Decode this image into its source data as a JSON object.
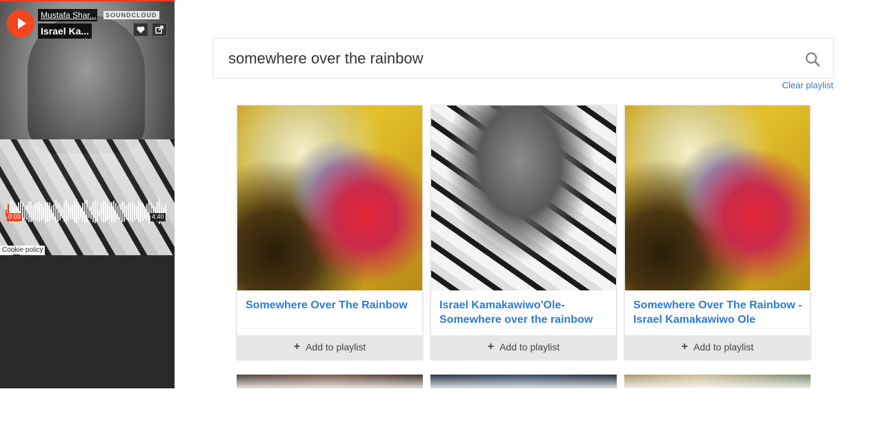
{
  "player": {
    "artist": "Mustafa Shar...",
    "track": "Israel Ka...",
    "brand": "SOUNDCLOUD",
    "current_time": "0:03",
    "duration": "4:40",
    "cookie_policy": "Cookie policy",
    "accent_color": "#f5451e"
  },
  "search": {
    "value": "somewhere over the rainbow",
    "icon": "search-icon"
  },
  "clear_playlist": "Clear playlist",
  "results": [
    {
      "title": "Somewhere Over The Rainbow",
      "add_label": "Add to playlist"
    },
    {
      "title": "Israel Kamakawiwo'Ole- Somewhere over the rainbow",
      "add_label": "Add to playlist"
    },
    {
      "title": "Somewhere Over The Rainbow - Israel Kamakawiwo Ole",
      "add_label": "Add to playlist"
    }
  ],
  "colors": {
    "link": "#2e7bd3",
    "sidebar_bg": "#2a2a2a",
    "button_bg": "#e6e6e6"
  }
}
